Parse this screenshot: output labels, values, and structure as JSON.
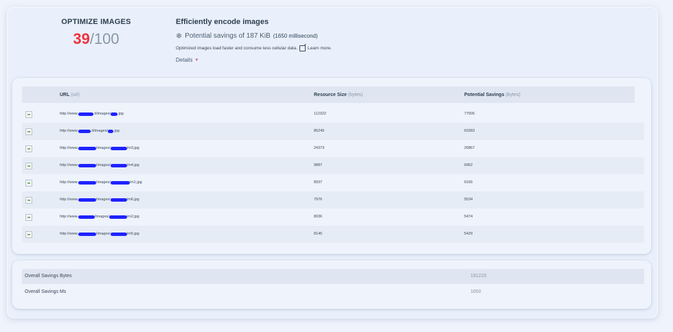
{
  "score": {
    "title": "OPTIMIZE IMAGES",
    "value": "39",
    "max": "/100",
    "color": "#f0323d"
  },
  "audit": {
    "title": "Efficiently encode images",
    "icon": "snowflake-icon",
    "savings": "Potential savings of 187 KiB",
    "savings_ms": "(1650 millisecond)",
    "note": "Optimized images load faster and consume less cellular data.",
    "learn_more": "Learn more.",
    "details": "Details"
  },
  "table": {
    "headers": {
      "url": "URL",
      "url_unit": "(url)",
      "size": "Resource Size",
      "size_unit": "(bytes)",
      "savings": "Potential Savings",
      "savings_unit": "(bytes)"
    },
    "rows": [
      {
        "url_a": "http://www.",
        "url_b": ".it/images/",
        "url_c": ".jpg",
        "size": "112322",
        "savings": "77506"
      },
      {
        "url_a": "http://www.",
        "url_b": ".it/images/",
        "url_c": ".jpg",
        "size": "85245",
        "savings": "63283"
      },
      {
        "url_a": "http://www.",
        "url_b": "/images/",
        "url_c": "/m3.jpg",
        "size": "24373",
        "savings": "20867"
      },
      {
        "url_a": "http://www.",
        "url_b": "/images/",
        "url_c": "/m4.jpg",
        "size": "9887",
        "savings": "6962"
      },
      {
        "url_a": "http://www.",
        "url_b": "/images/",
        "url_c": "/m1.jpg",
        "size": "8937",
        "savings": "6165"
      },
      {
        "url_a": "http://www.",
        "url_b": "/images/",
        "url_c": "/m6.jpg",
        "size": "7976",
        "savings": "5534"
      },
      {
        "url_a": "http://www.",
        "url_b": "/images/",
        "url_c": "/m2.jpg",
        "size": "8036",
        "savings": "5474"
      },
      {
        "url_a": "http://www.",
        "url_b": "/images/",
        "url_c": "/m5.jpg",
        "size": "8145",
        "savings": "5429"
      }
    ]
  },
  "summary": {
    "bytes_label": "Overall Savings Bytes",
    "bytes_value": "191220",
    "ms_label": "Overall Savings Ms",
    "ms_value": "1650"
  },
  "colors": {
    "accent_score": "#f0323d",
    "redaction": "#1e23ff",
    "background": "#eef3fc"
  }
}
